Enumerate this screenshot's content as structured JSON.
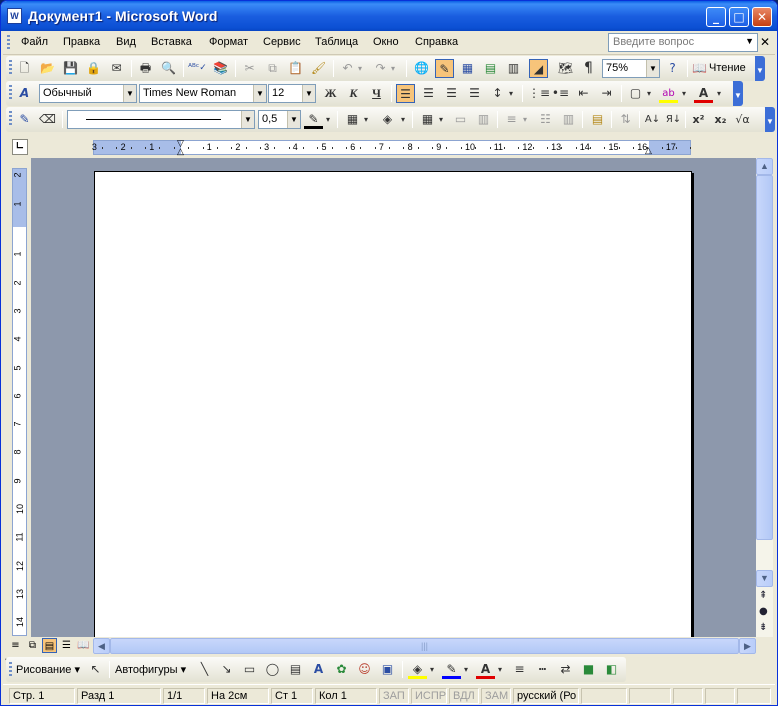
{
  "window": {
    "title": "Документ1 - Microsoft Word",
    "icon_name": "word-icon",
    "minimize": "_",
    "maximize": "□",
    "close": "✕"
  },
  "menu": {
    "items": [
      "Файл",
      "Правка",
      "Вид",
      "Вставка",
      "Формат",
      "Сервис",
      "Таблица",
      "Окно",
      "Справка"
    ],
    "help_placeholder": "Введите вопрос"
  },
  "standard": {
    "zoom": "75%",
    "reading_label": "Чтение"
  },
  "formatting": {
    "style": "Обычный",
    "font": "Times New Roman",
    "size": "12"
  },
  "tables_borders": {
    "line_weight": "0,5"
  },
  "ruler": {
    "h_labels": [
      "3",
      "2",
      "1",
      "1",
      "2",
      "3",
      "4",
      "5",
      "6",
      "7",
      "8",
      "9",
      "10",
      "11",
      "12",
      "13",
      "14",
      "15",
      "16",
      "17"
    ],
    "v_labels": [
      "2",
      "1",
      "1",
      "2",
      "3",
      "4",
      "5",
      "6",
      "7",
      "8",
      "9",
      "10",
      "11",
      "12",
      "13",
      "14"
    ]
  },
  "drawing": {
    "draw_label": "Рисование",
    "autoshapes_label": "Автофигуры"
  },
  "status": {
    "page": "Стр.  1",
    "section": "Разд  1",
    "page_of": "1/1",
    "at": "На  2см",
    "line": "Ст  1",
    "col": "Кол  1",
    "rec": "ЗАП",
    "trk": "ИСПР",
    "ext": "ВДЛ",
    "ovr": "ЗАМ",
    "language": "русский (Ро"
  },
  "colors": {
    "titlebar": "#0a5fe4",
    "accent_active": "#f7c47a",
    "workspace": "#8d98ac",
    "ruler_margin": "#a8bde8"
  }
}
